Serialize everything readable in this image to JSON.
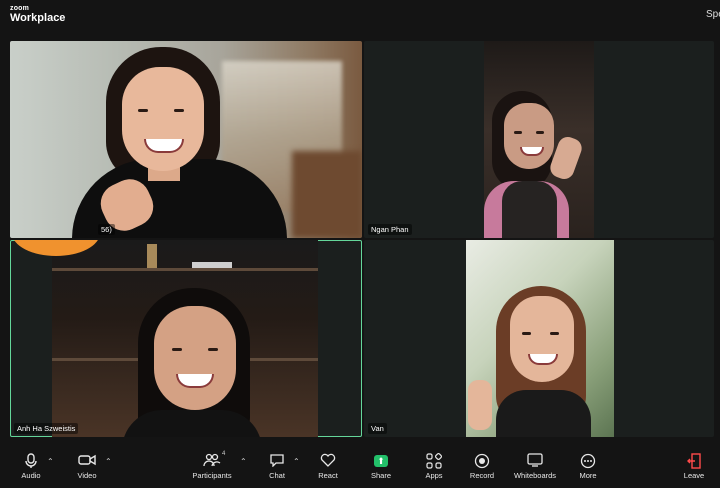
{
  "app": {
    "brand_small": "zoom",
    "brand_name": "Workplace",
    "view_label": "Speaker View"
  },
  "participants": [
    {
      "name": "",
      "name_fragment": "56)"
    },
    {
      "name": "Ngan Phan"
    },
    {
      "name": "Anh Ha Szweistis",
      "active_speaker": true
    },
    {
      "name": "Van"
    }
  ],
  "toolbar": {
    "audio": "Audio",
    "video": "Video",
    "participants": "Participants",
    "participants_count": "4",
    "chat": "Chat",
    "react": "React",
    "share": "Share",
    "apps": "Apps",
    "record": "Record",
    "whiteboards": "Whiteboards",
    "more": "More",
    "leave": "Leave"
  },
  "colors": {
    "active_border": "#64d69a",
    "share_green": "#23c06a",
    "leave_red": "#ff4a4a",
    "reaction_bubble": "#f0922e"
  }
}
